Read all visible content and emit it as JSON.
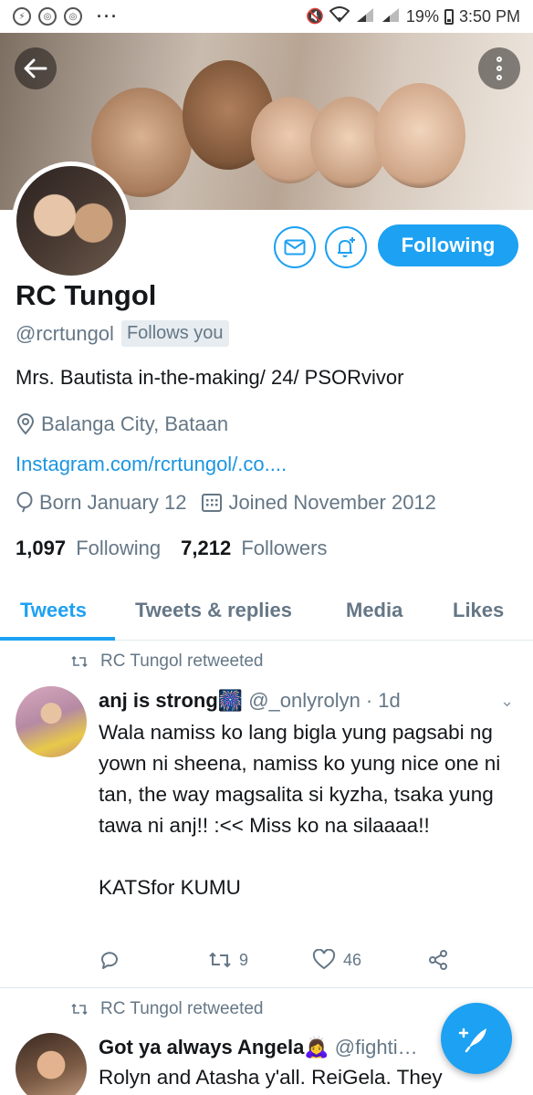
{
  "status_bar": {
    "battery": "19%",
    "time": "3:50 PM",
    "app_icons": [
      "messenger-icon",
      "chrome-icon",
      "chrome-icon"
    ],
    "dots": "···"
  },
  "header": {
    "back_icon": "arrow-left-icon",
    "more_icon": "more-vertical-icon"
  },
  "profile": {
    "name": "RC Tungol",
    "handle": "@rcrtungol",
    "follows_you": "Follows you",
    "bio": "Mrs. Bautista in-the-making/ 24/  PSORvivor",
    "location": "Balanga City, Bataan",
    "link": "Instagram.com/rcrtungol/.co....",
    "born": "Born January 12",
    "joined": "Joined November 2012",
    "following_count": "1,097",
    "following_label": "Following",
    "followers_count": "7,212",
    "followers_label": "Followers",
    "follow_button": "Following"
  },
  "tabs": [
    {
      "label": "Tweets",
      "active": true
    },
    {
      "label": "Tweets & replies",
      "active": false
    },
    {
      "label": "Media",
      "active": false
    },
    {
      "label": "Likes",
      "active": false
    }
  ],
  "tweets": [
    {
      "retweeted_by": "RC Tungol retweeted",
      "name": "anj is strong🎆",
      "handle": "@_onlyrolyn",
      "time": "· 1d",
      "text": "Wala namiss ko lang bigla yung pagsabi ng yown ni sheena, namiss ko yung nice one ni tan, the way magsalita si kyzha, tsaka yung tawa ni anj!! :<< Miss ko na silaaaa!!\n\nKATSfor KUMU",
      "replies": "",
      "retweets": "9",
      "likes": "46"
    },
    {
      "retweeted_by": "RC Tungol retweeted",
      "name": "Got ya always Angela🙇‍♀️",
      "handle": "@fighti…",
      "time": "",
      "text": "Rolyn and Atasha y'all. ReiGela. They"
    }
  ],
  "colors": {
    "accent": "#1da1f2",
    "link": "#1b95e0",
    "secondary_text": "#657786",
    "primary_text": "#14171a"
  }
}
